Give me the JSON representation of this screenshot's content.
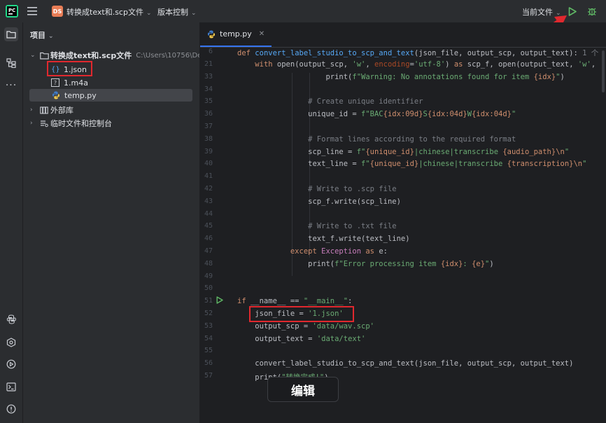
{
  "titlebar": {
    "project_badge": "DS",
    "project_name": "转换成text和.scp文件",
    "vcs_label": "版本控制",
    "run_config": "当前文件"
  },
  "sidebar": {
    "header": "项目",
    "root_name": "转换成text和.scp文件",
    "root_path": "C:\\Users\\10756\\Deskto",
    "files": [
      {
        "name": "1.json"
      },
      {
        "name": "1.m4a"
      },
      {
        "name": "temp.py"
      }
    ],
    "external_libs": "外部库",
    "scratches": "临时文件和控制台"
  },
  "editor": {
    "tab_name": "temp.py",
    "line_numbers": [
      "6",
      "21",
      "33",
      "34",
      "35",
      "36",
      "37",
      "38",
      "39",
      "40",
      "41",
      "42",
      "43",
      "44",
      "45",
      "46",
      "47",
      "48",
      "49",
      "50",
      "51",
      "52",
      "53",
      "54",
      "55",
      "56",
      "57"
    ],
    "header_line_1": {
      "kw": "def ",
      "fn": "convert_label_studio_to_scp_and_text",
      "rest": "(json_file, output_scp, output_text):",
      "hint": "1 个"
    },
    "header_line_2": {
      "kw": "with ",
      "rest1": "open(output_scp, ",
      "s1": "'w'",
      "rest2": ", ",
      "param": "encoding",
      "rest3": "=",
      "s2": "'utf-8'",
      "rest4": ") ",
      "kw2": "as",
      "rest5": " scp_f, open(output_text, ",
      "s3": "'w'",
      "rest6": ","
    },
    "l33": {
      "pre": "print(",
      "s": "f\"Warning: No annotations found for item ",
      "brace": "{idx}",
      "s2": "\"",
      "post": ")"
    },
    "l35": "# Create unique identifier",
    "l36": {
      "pre": "unique_id = ",
      "s1": "f\"BAC",
      "b1": "{idx:09d}",
      "s2": "S",
      "b2": "{idx:04d}",
      "s3": "W",
      "b3": "{idx:04d}",
      "s4": "\""
    },
    "l38": "# Format lines according to the required format",
    "l39": {
      "pre": "scp_line = ",
      "s1": "f\"",
      "b1": "{unique_id}",
      "s2": "|chinese|transcribe ",
      "b2": "{audio_path}",
      "e": "\\n",
      "s3": "\""
    },
    "l40": {
      "pre": "text_line = ",
      "s1": "f\"",
      "b1": "{unique_id}",
      "s2": "|chinese|transcribe ",
      "b2": "{transcription}",
      "e": "\\n",
      "s3": "\""
    },
    "l42": "# Write to .scp file",
    "l43": "scp_f.write(scp_line)",
    "l45": "# Write to .txt file",
    "l46": "text_f.write(text_line)",
    "l47": {
      "kw": "except ",
      "cls": "Exception",
      "kw2": " as ",
      "rest": "e:"
    },
    "l48": {
      "pre": "print(",
      "s": "f\"Error processing item ",
      "b1": "{idx}",
      "s2": ": ",
      "b2": "{e}",
      "s3": "\"",
      "post": ")"
    },
    "l51": {
      "kw": "if ",
      "rest": "__name__ == ",
      "s": "\"__main__\"",
      "post": ":"
    },
    "l52": {
      "pre": "json_file = ",
      "s": "'1.json'"
    },
    "l53": {
      "pre": "output_scp = ",
      "s": "'data/wav.scp'"
    },
    "l54": {
      "pre": "output_text = ",
      "s": "'data/text'"
    },
    "l56": "convert_label_studio_to_scp_and_text(json_file, output_scp, output_text)",
    "l57": {
      "pre": "print(",
      "s": "\"转换完成!\"",
      "post": ")"
    }
  },
  "tooltip": "编辑",
  "colors": {
    "accent": "#3574f0",
    "annotation": "#e0282e",
    "run": "#5fb865"
  }
}
